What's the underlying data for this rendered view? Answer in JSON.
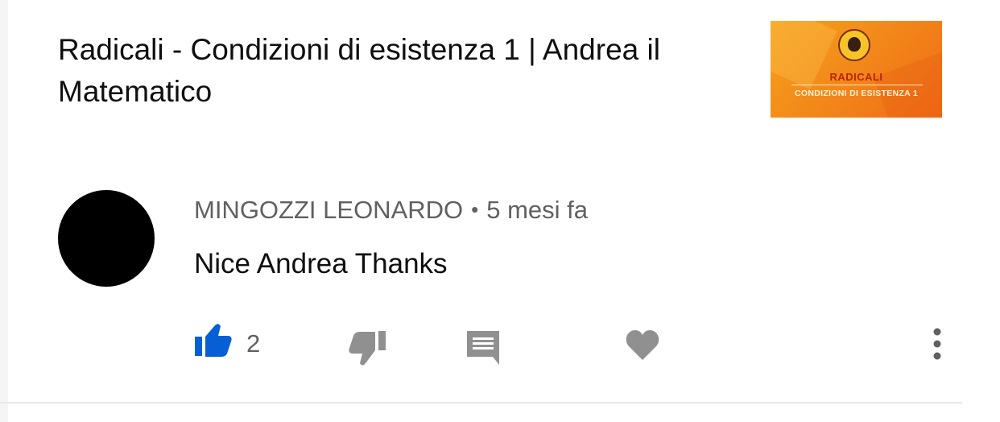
{
  "video": {
    "title": "Radicali - Condizioni di esistenza 1 | Andrea il Matematico",
    "thumbnail": {
      "title": "RADICALI",
      "subtitle": "CONDIZIONI DI ESISTENZA 1"
    }
  },
  "comment": {
    "author": "MINGOZZI LEONARDO",
    "separator": "•",
    "timestamp": "5 mesi fa",
    "text": "Nice Andrea Thanks",
    "like_count": "2",
    "liked": true
  },
  "icons": {
    "like": "thumb-up-icon",
    "dislike": "thumb-down-icon",
    "reply": "comment-icon",
    "heart": "heart-icon",
    "menu": "more-vert-icon"
  },
  "colors": {
    "like_active": "#065fd4",
    "icon_gray": "#909090",
    "meta_text": "#606060",
    "thumbnail_orange": "#f28a1a"
  }
}
